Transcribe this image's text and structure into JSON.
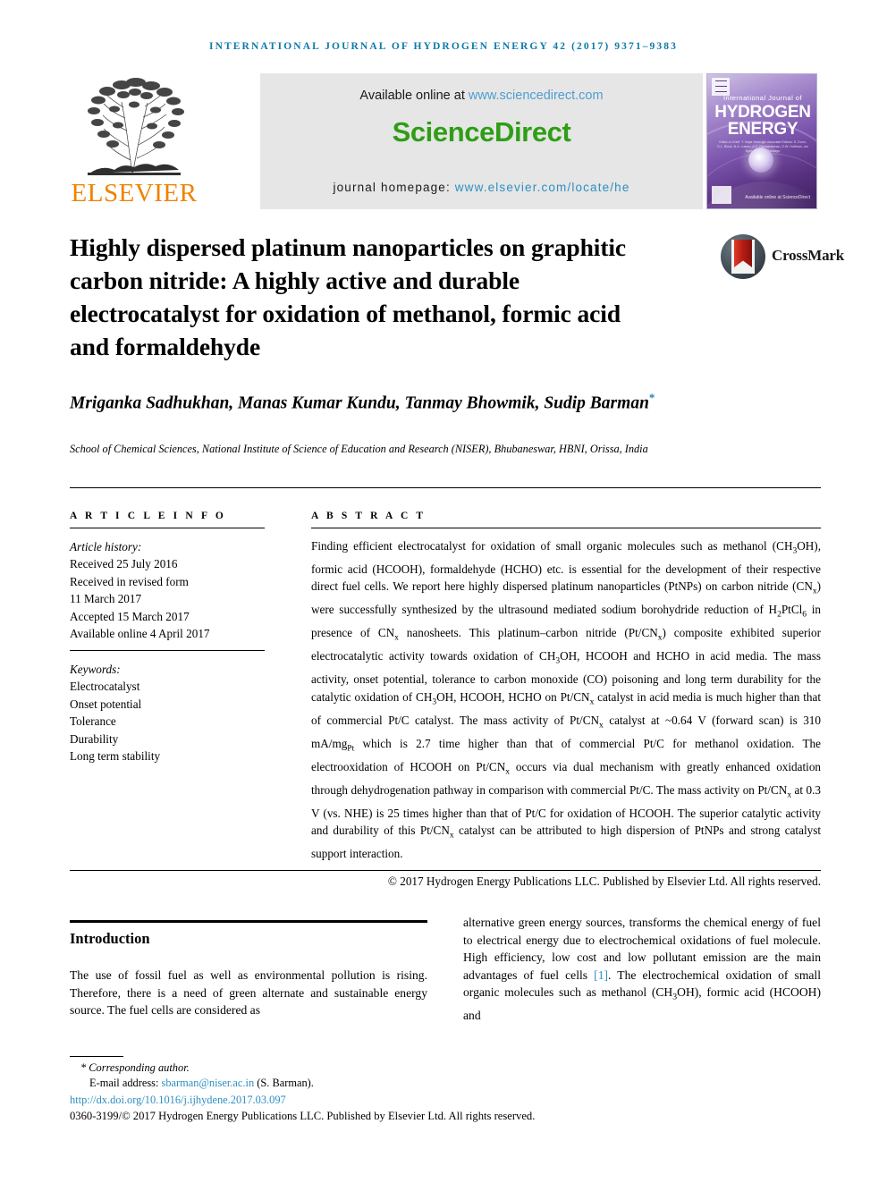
{
  "running_head": "International Journal of Hydrogen Energy 42 (2017) 9371–9383",
  "masthead": {
    "publisher_name": "ELSEVIER",
    "tree_logo_alt": "elsevier-tree-logo",
    "available_prefix": "Available online at ",
    "available_url": "www.sciencedirect.com",
    "sciencedirect_wordmark": "ScienceDirect",
    "homepage_prefix": "journal homepage: ",
    "homepage_url": "www.elsevier.com/locate/he",
    "cover": {
      "line_small": "International Journal of",
      "line_big_1": "HYDROGEN",
      "line_big_2": "ENERGY",
      "editors": "Editor-in-Chief: T. Nejat Veziroğlu    Associate Editors: S. Dunn, D.L. Block, N.A. Lutsen, A.C. Ramakrishnan, D.W. Hoffman, Ion Dyer, and D.A. Santiago",
      "footer_mark": "Available online at ScienceDirect"
    }
  },
  "crossmark": {
    "label": "CrossMark",
    "icon": "crossmark-badge-icon"
  },
  "article": {
    "title": "Highly dispersed platinum nanoparticles on graphitic carbon nitride: A highly active and durable electrocatalyst for oxidation of methanol, formic acid and formaldehyde",
    "authors": "Mriganka Sadhukhan, Manas Kumar Kundu, Tanmay Bhowmik, Sudip Barman",
    "corresponding_marker": "*",
    "affiliation": "School of Chemical Sciences, National Institute of Science of Education and Research (NISER), Bhubaneswar, HBNI, Orissa, India"
  },
  "article_info": {
    "caption": "A R T I C L E   I N F O",
    "history_label": "Article history:",
    "history": [
      "Received 25 July 2016",
      "Received in revised form",
      "11 March 2017",
      "Accepted 15 March 2017",
      "Available online 4 April 2017"
    ],
    "keywords_label": "Keywords:",
    "keywords": [
      "Electrocatalyst",
      "Onset potential",
      "Tolerance",
      "Durability",
      "Long term stability"
    ]
  },
  "abstract": {
    "caption": "A B S T R A C T",
    "copyright": "© 2017 Hydrogen Energy Publications LLC. Published by Elsevier Ltd. All rights reserved."
  },
  "introduction": {
    "heading": "Introduction",
    "left_paragraph": "The use of fossil fuel as well as environmental pollution is rising. Therefore, there is a need of green alternate and sustainable energy source. The fuel cells are considered as",
    "right_paragraph_start": "alternative green energy sources, transforms the chemical energy of fuel to electrical energy due to electrochemical oxidations of fuel molecule. High efficiency, low cost and low pollutant emission are the main advantages of fuel cells ",
    "citation": "[1]",
    "right_paragraph_end": ". The electrochemical oxidation of small organic molecules such as methanol (CH3OH), formic acid (HCOOH) and"
  },
  "footer": {
    "corresponding": "* Corresponding author.",
    "email_label": "E-mail address: ",
    "email": "sbarman@niser.ac.in",
    "email_owner": " (S. Barman).",
    "doi": "http://dx.doi.org/10.1016/j.ijhydene.2017.03.097",
    "issn_copyright": "0360-3199/© 2017 Hydrogen Energy Publications LLC. Published by Elsevier Ltd. All rights reserved."
  },
  "colors": {
    "running_head": "#0b7aa8",
    "elsevier_orange": "#ef8200",
    "sciencedirect_green": "#2f9e16",
    "link_blue": "#2e8fc0",
    "banner_gray": "#e6e6e6"
  }
}
